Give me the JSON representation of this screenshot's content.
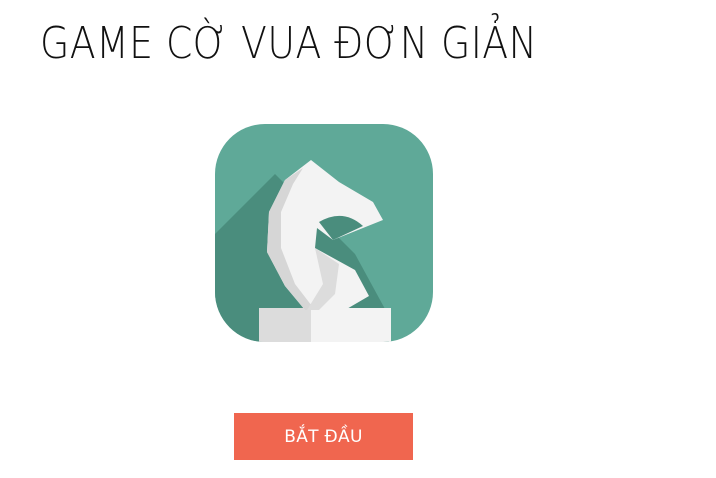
{
  "header": {
    "title": "GAME CỜ VUA ĐƠN GIẢN"
  },
  "logo": {
    "icon": "chess-knight-icon",
    "background_color": "#5fa998",
    "shadow_color": "#4a8d7d",
    "piece_color": "#f3f3f3"
  },
  "actions": {
    "start_label": "BẮT ĐẦU",
    "start_color": "#f0664f"
  }
}
